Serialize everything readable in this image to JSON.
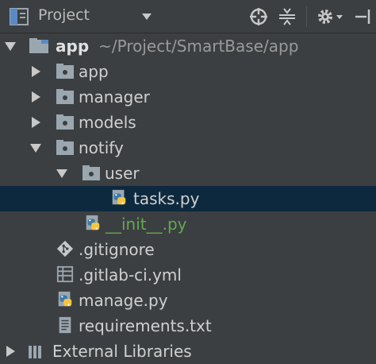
{
  "toolbar": {
    "title": "Project",
    "icons": [
      "project-view-icon",
      "dropdown-arrow-icon",
      "locate-crosshair-icon",
      "collapse-all-icon",
      "settings-gear-icon",
      "hide-panel-icon"
    ]
  },
  "tree": {
    "root": {
      "name": "app",
      "path": "~/Project/SmartBase/app"
    },
    "items": [
      {
        "label": "app"
      },
      {
        "label": "manager"
      },
      {
        "label": "models"
      },
      {
        "label": "notify"
      },
      {
        "label": "user"
      },
      {
        "label": "tasks.py"
      },
      {
        "label": "__init__.py"
      },
      {
        "label": ".gitignore"
      },
      {
        "label": ".gitlab-ci.yml"
      },
      {
        "label": "manage.py"
      },
      {
        "label": "requirements.txt"
      },
      {
        "label": "External Libraries"
      }
    ]
  },
  "colors": {
    "background": "#3c3f41",
    "selection": "#0d293e",
    "init_file_text": "#62a851",
    "python_blue": "#3c78aa",
    "python_yellow": "#f4c542"
  }
}
